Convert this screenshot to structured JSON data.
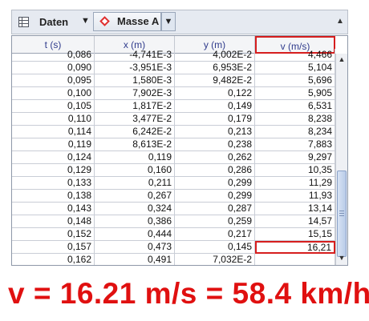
{
  "toolbar": {
    "table_icon": "table-grid-icon",
    "daten_label": "Daten",
    "daten_arrow": "▼",
    "masse_icon": "red-diamond-icon",
    "masse_label": "Masse A",
    "masse_drop": "▼",
    "collapse": "▲"
  },
  "table": {
    "headers": [
      "t (s)",
      "x (m)",
      "y (m)",
      "v (m/s)"
    ],
    "rows": [
      [
        "0,086",
        "-4,741E-3",
        "4,002E-2",
        "4,466"
      ],
      [
        "0,090",
        "-3,951E-3",
        "6,953E-2",
        "5,104"
      ],
      [
        "0,095",
        "1,580E-3",
        "9,482E-2",
        "5,696"
      ],
      [
        "0,100",
        "7,902E-3",
        "0,122",
        "5,905"
      ],
      [
        "0,105",
        "1,817E-2",
        "0,149",
        "6,531"
      ],
      [
        "0,110",
        "3,477E-2",
        "0,179",
        "8,238"
      ],
      [
        "0,114",
        "6,242E-2",
        "0,213",
        "8,234"
      ],
      [
        "0,119",
        "8,613E-2",
        "0,238",
        "7,883"
      ],
      [
        "0,124",
        "0,119",
        "0,262",
        "9,297"
      ],
      [
        "0,129",
        "0,160",
        "0,286",
        "10,35"
      ],
      [
        "0,133",
        "0,211",
        "0,299",
        "11,29"
      ],
      [
        "0,138",
        "0,267",
        "0,299",
        "11,93"
      ],
      [
        "0,143",
        "0,324",
        "0,287",
        "13,14"
      ],
      [
        "0,148",
        "0,386",
        "0,259",
        "14,57"
      ],
      [
        "0,152",
        "0,444",
        "0,217",
        "15,15"
      ],
      [
        "0,157",
        "0,473",
        "0,145",
        "16,21"
      ],
      [
        "0,162",
        "0,491",
        "7,032E-2",
        ""
      ]
    ],
    "highlighted_row_index": 15,
    "highlight_color": "#d61e1e",
    "header_text_color": "#2f3b8c"
  },
  "scrollbar": {
    "up": "▲",
    "down": "▼"
  },
  "caption": "v = 16.21 m/s = 58.4 km/h"
}
